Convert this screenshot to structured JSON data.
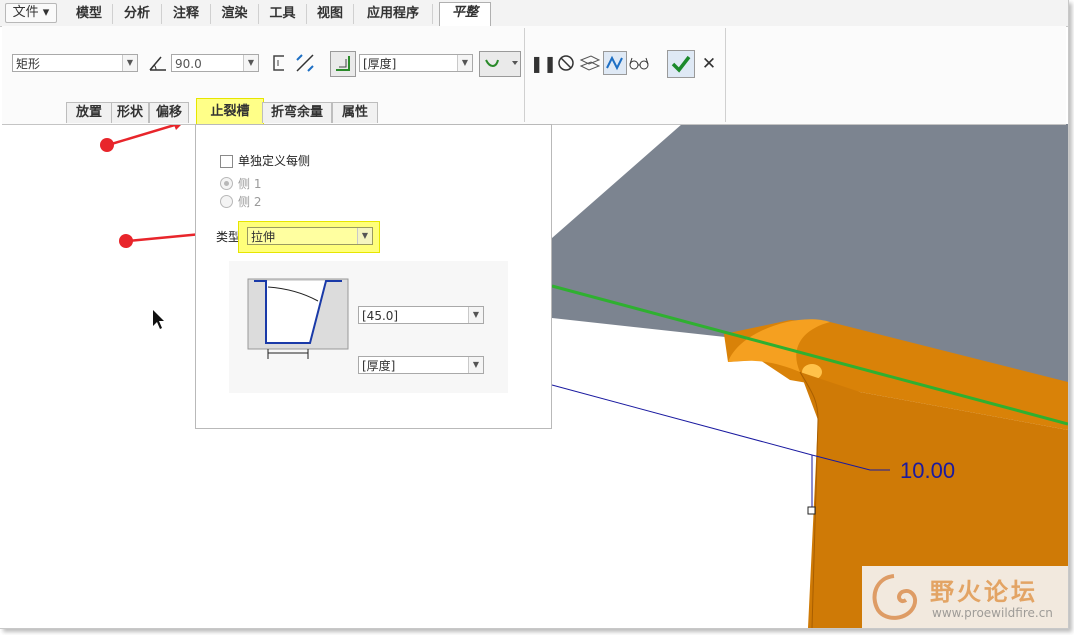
{
  "menubar": {
    "items": [
      "文件 ▾",
      "模型",
      "分析",
      "注释",
      "渲染",
      "工具",
      "视图",
      "应用程序",
      "平整"
    ],
    "active": "平整"
  },
  "toolbar": {
    "shape_value": "矩形",
    "angle_value": "90.0",
    "thickness_value": "[厚度]"
  },
  "subtabs": [
    "放置",
    "形状",
    "偏移",
    "止裂槽",
    "折弯余量",
    "属性"
  ],
  "active_subtab": "止裂槽",
  "panel": {
    "define_each_side_label": "单独定义每侧",
    "side1_label": "侧 1",
    "side2_label": "侧 2",
    "type_label": "类型",
    "type_value": "拉伸",
    "angle_field": "[45.0]",
    "thickness_field": "[厚度]"
  },
  "viewport": {
    "dimension_text": "10.00"
  },
  "watermark": {
    "title": "野火论坛",
    "url": "www.proewildfire.cn"
  },
  "colors": {
    "accent_highlight": "#ffff7a",
    "arrow_red": "#e8252b",
    "dimension_blue": "#1a1aa0",
    "part_orange": "#d98208",
    "plane_gray": "#7c8490",
    "edge_green": "#2fb030"
  }
}
